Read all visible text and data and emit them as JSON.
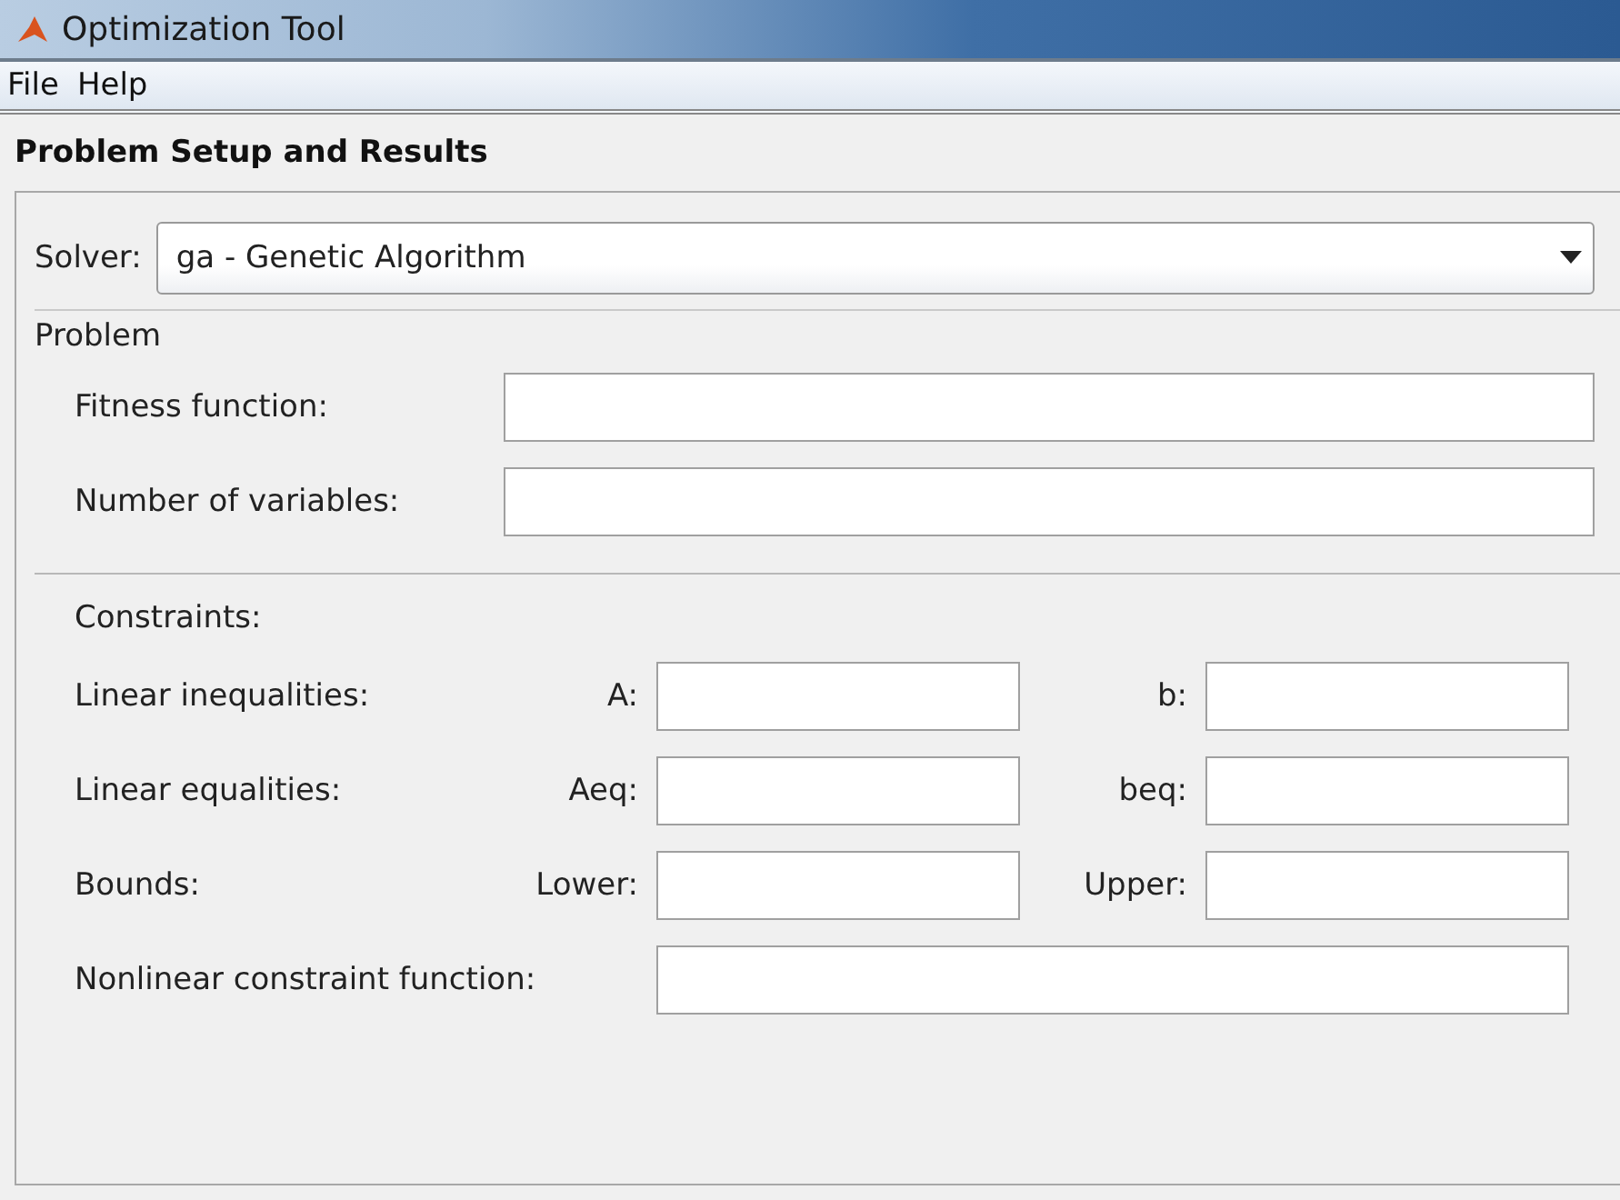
{
  "window": {
    "title": "Optimization Tool"
  },
  "menu": [
    "File",
    "Help"
  ],
  "section_title": "Problem Setup and Results",
  "solver": {
    "label": "Solver:",
    "value": "ga - Genetic Algorithm"
  },
  "problem": {
    "title": "Problem",
    "fields": [
      {
        "label": "Fitness function:"
      },
      {
        "label": "Number of variables:"
      }
    ]
  },
  "constraints": {
    "title": "Constraints:",
    "rows": [
      {
        "kind": "pair",
        "label": "Linear inequalities:",
        "fields": [
          {
            "label": "A:"
          },
          {
            "label": "b:"
          }
        ]
      },
      {
        "kind": "pair",
        "label": "Linear equalities:",
        "fields": [
          {
            "label": "Aeq:"
          },
          {
            "label": "beq:"
          }
        ]
      },
      {
        "kind": "pair",
        "label": "Bounds:",
        "fields": [
          {
            "label": "Lower:"
          },
          {
            "label": "Upper:"
          }
        ]
      },
      {
        "kind": "single",
        "label": "Nonlinear constraint function:"
      }
    ]
  }
}
